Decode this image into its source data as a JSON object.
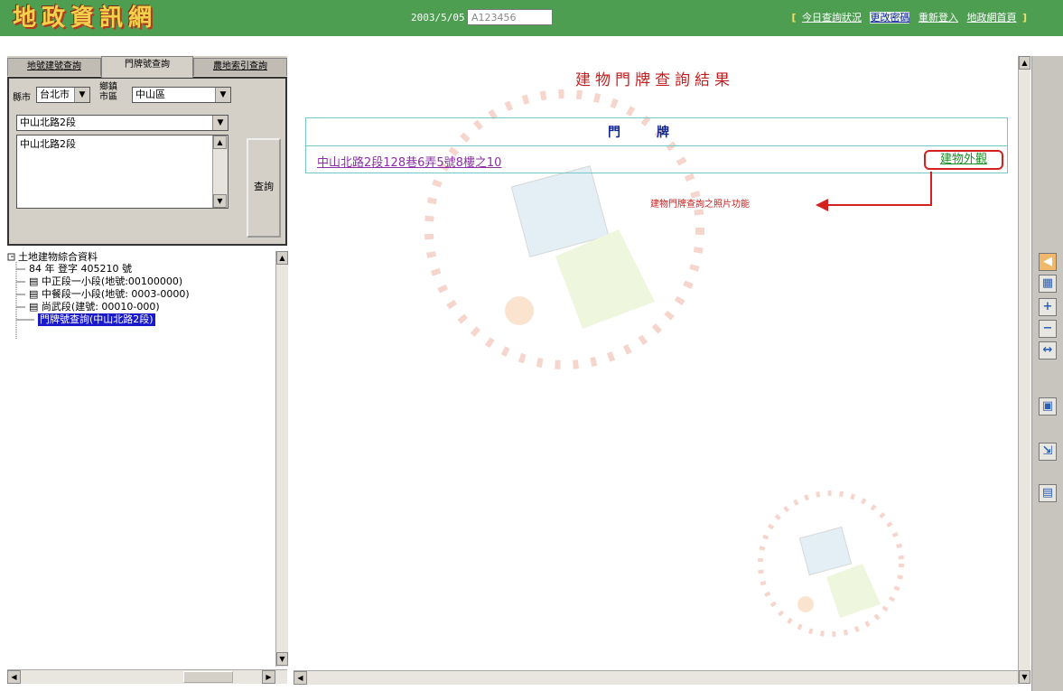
{
  "header": {
    "app_title": "地政資訊網",
    "date": "2003/5/05",
    "user_field": "A123456",
    "links": [
      "今日查詢狀況",
      "更改密碼",
      "重新登入",
      "地政網首頁"
    ],
    "link_brackets": [
      "[",
      "]"
    ]
  },
  "query": {
    "tabs": [
      "地號建號查詢",
      "門牌號查詢",
      "農地索引查詢"
    ],
    "city_label": "縣市",
    "city_value": "台北市",
    "district_label": "鄉鎮市區",
    "district_value": "中山區",
    "road_value": "中山北路2段",
    "road_list": [
      "中山北路2段"
    ],
    "search_label": "查詢"
  },
  "tree": {
    "root": "土地建物綜合資料",
    "items": [
      "84 年 登字 405210 號",
      "中正段一小段(地號:00100000)",
      "中餐段一小段(地號: 0003-0000)",
      "尚武段(建號: 00010-000)"
    ],
    "selected": "門牌號查詢(中山北路2段)"
  },
  "result": {
    "title": "建物門牌查詢結果",
    "column_header": "門牌",
    "address": "中山北路2段128巷6弄5號8樓之10",
    "photo_link": "建物外觀",
    "annotation": "建物門牌查詢之照片功能"
  },
  "colors": {
    "header_bg": "#4e9e52",
    "title_red": "#c41f1f",
    "table_border": "#73c7c9",
    "link_green": "#1b8e25",
    "link_purple": "#8c2fa6"
  },
  "toolbar_icons": [
    "back-arrow-icon",
    "grid-icon",
    "zoom-in-icon",
    "zoom-out-icon",
    "pan-icon",
    "print-icon",
    "export-icon",
    "map-icon"
  ]
}
